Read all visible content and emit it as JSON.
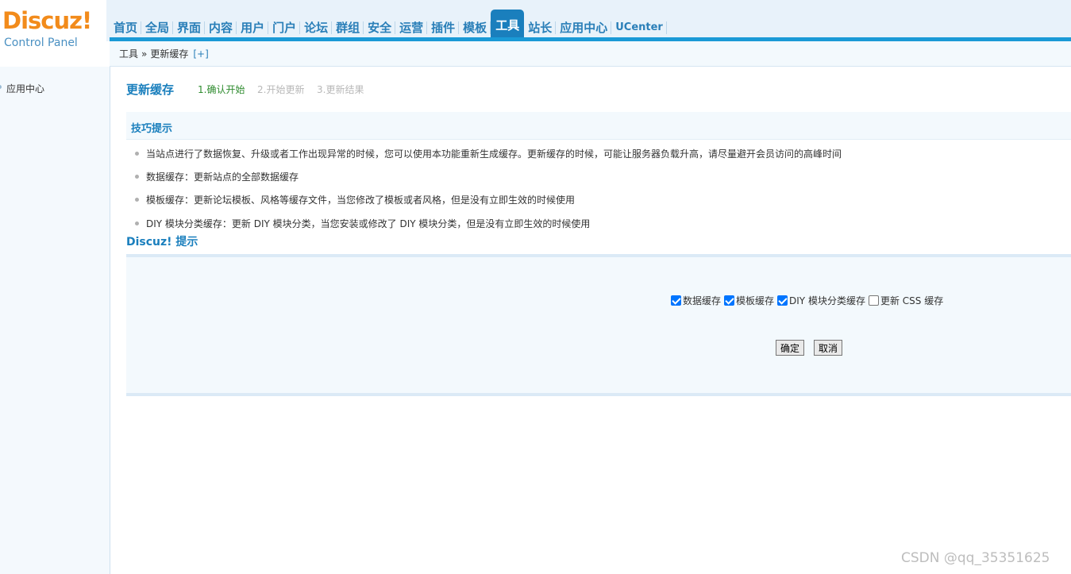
{
  "logo": {
    "brand": "Discuz!",
    "sub": "Control Panel"
  },
  "nav": {
    "items": [
      "首页",
      "全局",
      "界面",
      "内容",
      "用户",
      "门户",
      "论坛",
      "群组",
      "安全",
      "运营",
      "插件",
      "模板",
      "工具",
      "站长",
      "应用中心",
      "UCenter"
    ],
    "active": "工具"
  },
  "breadcrumb": {
    "parent": "工具",
    "sep": "»",
    "current": "更新缓存",
    "plus": "[+]"
  },
  "sidebar": {
    "items": [
      "应用中心"
    ]
  },
  "main": {
    "title": "更新缓存",
    "steps": [
      "1.确认开始",
      "2.开始更新",
      "3.更新结果"
    ],
    "tips_title": "技巧提示",
    "tips": [
      "当站点进行了数据恢复、升级或者工作出现异常的时候，您可以使用本功能重新生成缓存。更新缓存的时候，可能让服务器负载升高，请尽量避开会员访问的高峰时间",
      "数据缓存：更新站点的全部数据缓存",
      "模板缓存：更新论坛模板、风格等缓存文件，当您修改了模板或者风格，但是没有立即生效的时候使用",
      "DIY 模块分类缓存：更新 DIY 模块分类，当您安装或修改了 DIY 模块分类，但是没有立即生效的时候使用"
    ],
    "discuz_title": "Discuz! 提示",
    "options": [
      {
        "label": "数据缓存",
        "checked": true
      },
      {
        "label": "模板缓存",
        "checked": true
      },
      {
        "label": "DIY 模块分类缓存",
        "checked": true
      },
      {
        "label": "更新 CSS 缓存",
        "checked": false
      }
    ],
    "ok_label": "确定",
    "cancel_label": "取消"
  },
  "watermark": "CSDN @qq_35351625",
  "colors": {
    "accent": "#1a7fbd",
    "brand": "#f28b1b",
    "step_active": "#2e8b2e",
    "step_inactive": "#b8b8b8"
  }
}
